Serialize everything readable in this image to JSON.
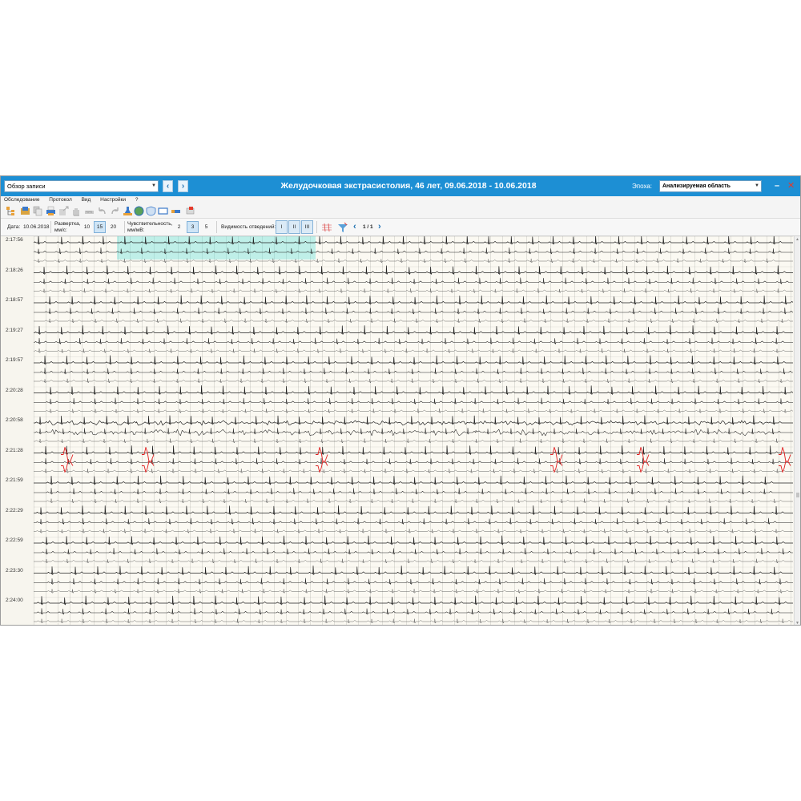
{
  "titlebar": {
    "view_select": "Обзор записи",
    "title": "Желудочковая экстрасистолия, 46 лет, 09.06.2018 - 10.06.2018",
    "epoch_label": "Эпоха:",
    "epoch_value": "Анализируемая область",
    "minimize_glyph": "–",
    "close_glyph": "✕",
    "accent": "#1d8fd4"
  },
  "menu": [
    "Обследование",
    "Протокол",
    "Вид",
    "Настройки",
    "?"
  ],
  "toolbar_icons": [
    "tree-icon",
    "open-icon",
    "copy-icon",
    "print-icon",
    "export-icon",
    "hand-icon",
    "undo-icon",
    "redo-icon",
    "measure-icon",
    "globe-icon",
    "shield-icon",
    "rectangle-icon",
    "ruler-icon",
    "flag-icon"
  ],
  "controls": {
    "date_label": "Дата:",
    "date_value": "10.06.2018",
    "sweep_label": "Развертка,",
    "sweep_unit": "мм/с:",
    "sweep_options": [
      "10",
      "15",
      "20"
    ],
    "sweep_active": "15",
    "sens_label": "Чувствительность,",
    "sens_unit": "мм/мВ:",
    "sens_options": [
      "2",
      "3",
      "5"
    ],
    "sens_active": "3",
    "visibility_label": "Видимость отведений:",
    "leads": [
      "I",
      "II",
      "III"
    ],
    "page_indicator": "1 / 1"
  },
  "ecg": {
    "rows": [
      "2:17:56",
      "2:18:26",
      "2:18:57",
      "2:19:27",
      "2:19:57",
      "2:20:28",
      "2:20:58",
      "2:21:28",
      "2:21:59",
      "2:22:29",
      "2:22:59",
      "2:23:30",
      "2:24:00"
    ],
    "highlight_row": "2:17:56",
    "artifact_row": "2:20:58",
    "pvc_row": "2:21:28",
    "trace_color": "#222222",
    "pvc_color": "#e02020",
    "highlight_color": "#50dcd7"
  }
}
